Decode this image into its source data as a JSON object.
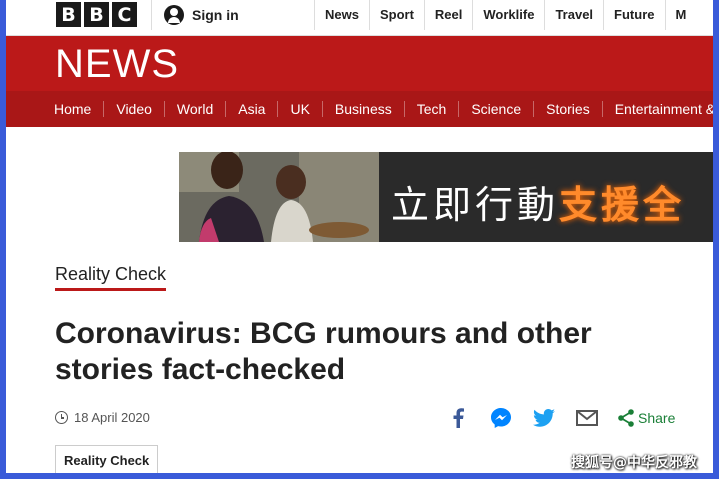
{
  "top_bar": {
    "logo_letters": [
      "B",
      "B",
      "C"
    ],
    "signin": {
      "icon": "user-icon",
      "label": "Sign in"
    },
    "nav": [
      "News",
      "Sport",
      "Reel",
      "Worklife",
      "Travel",
      "Future",
      "M"
    ]
  },
  "news_header": {
    "logo": "NEWS",
    "nav": [
      "Home",
      "Video",
      "World",
      "Asia",
      "UK",
      "Business",
      "Tech",
      "Science",
      "Stories",
      "Entertainment &"
    ]
  },
  "banner": {
    "text_plain": "立即行動",
    "text_emphasis": "支援全"
  },
  "article": {
    "section": "Reality Check",
    "headline": "Coronavirus: BCG rumours and other stories fact-checked",
    "date": "18 April 2020",
    "share": {
      "icons": [
        "facebook-icon",
        "messenger-icon",
        "twitter-icon",
        "email-icon",
        "share-icon"
      ],
      "label": "Share"
    },
    "tag": "Reality Check"
  },
  "watermark": "搜狐号@中华反邪教",
  "colors": {
    "brand_red": "#bb1919",
    "nav_red": "#a91717",
    "share_green": "#1a7f37",
    "border_blue": "#3a5bd9"
  }
}
